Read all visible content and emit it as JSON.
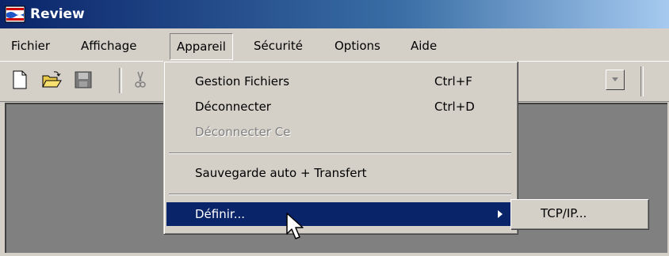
{
  "window": {
    "title": "Review",
    "app_icon": "app-icon"
  },
  "menubar": {
    "items": [
      "Fichier",
      "Affichage",
      "Appareil",
      "Sécurité",
      "Options",
      "Aide"
    ],
    "active": "Appareil"
  },
  "toolbar": {
    "icons": [
      "new-document-icon",
      "open-folder-icon",
      "save-disk-icon",
      "cut-scissors-icon"
    ]
  },
  "dropdown": {
    "items": [
      {
        "label": "Gestion Fichiers",
        "shortcut": "Ctrl+F",
        "enabled": true
      },
      {
        "label": "Déconnecter",
        "shortcut": "Ctrl+D",
        "enabled": true
      },
      {
        "label": "Déconnecter Ce",
        "shortcut": "",
        "enabled": false
      },
      {
        "label": "Sauvegarde auto + Transfert",
        "shortcut": "",
        "enabled": true
      },
      {
        "label": "Définir...",
        "shortcut": "",
        "enabled": true,
        "submenu": true,
        "selected": true
      }
    ]
  },
  "submenu": {
    "items": [
      "TCP/IP..."
    ]
  },
  "colors": {
    "title_bar": "#0a246a",
    "selection": "#0a246a",
    "face": "#d4d0c8",
    "workspace": "#808080"
  }
}
